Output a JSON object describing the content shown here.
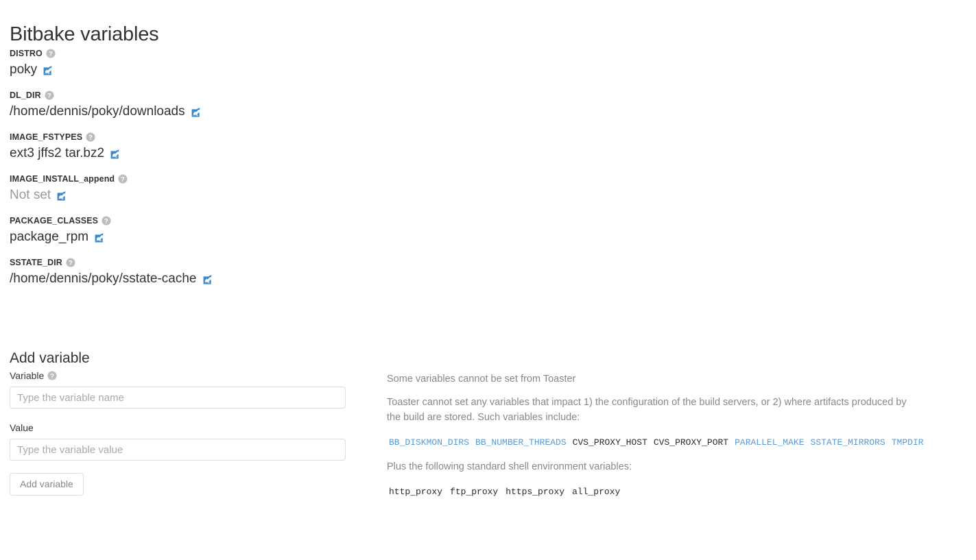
{
  "page": {
    "title": "Bitbake variables"
  },
  "variables": [
    {
      "name": "DISTRO",
      "value": "poky",
      "not_set": false,
      "help_icon": "help-circle-icon",
      "edit_icon": "edit-pencil-square-icon"
    },
    {
      "name": "DL_DIR",
      "value": "/home/dennis/poky/downloads",
      "not_set": false,
      "help_icon": "help-circle-icon",
      "edit_icon": "edit-pencil-square-icon"
    },
    {
      "name": "IMAGE_FSTYPES",
      "value": "ext3 jffs2 tar.bz2",
      "not_set": false,
      "help_icon": "help-circle-icon",
      "edit_icon": "edit-pencil-square-icon"
    },
    {
      "name": "IMAGE_INSTALL_append",
      "value": "Not set",
      "not_set": true,
      "help_icon": "help-circle-icon",
      "edit_icon": "edit-pencil-square-icon"
    },
    {
      "name": "PACKAGE_CLASSES",
      "value": "package_rpm",
      "not_set": false,
      "help_icon": "help-circle-icon",
      "edit_icon": "edit-pencil-square-icon"
    },
    {
      "name": "SSTATE_DIR",
      "value": "/home/dennis/poky/sstate-cache",
      "not_set": false,
      "help_icon": "help-circle-icon",
      "edit_icon": "edit-pencil-square-icon"
    }
  ],
  "add_variable_form": {
    "heading": "Add variable",
    "variable_label": "Variable",
    "variable_help_icon": "help-circle-icon",
    "variable_placeholder": "Type the variable name",
    "variable_value": "",
    "value_label": "Value",
    "value_placeholder": "Type the variable value",
    "value_value": "",
    "submit_label": "Add variable"
  },
  "info_panel": {
    "heading": "Some variables cannot be set from Toaster",
    "paragraph": "Toaster cannot set any variables that impact 1) the configuration of the build servers, or 2) where artifacts produced by the build are stored. Such variables include:",
    "restricted_variables": [
      {
        "name": "BB_DISKMON_DIRS",
        "is_link": true
      },
      {
        "name": "BB_NUMBER_THREADS",
        "is_link": true
      },
      {
        "name": "CVS_PROXY_HOST",
        "is_link": false
      },
      {
        "name": "CVS_PROXY_PORT",
        "is_link": false
      },
      {
        "name": "PARALLEL_MAKE",
        "is_link": true
      },
      {
        "name": "SSTATE_MIRRORS",
        "is_link": true
      },
      {
        "name": "TMPDIR",
        "is_link": true
      }
    ],
    "shell_intro": "Plus the following standard shell environment variables:",
    "shell_variables": [
      {
        "name": "http_proxy"
      },
      {
        "name": "ftp_proxy"
      },
      {
        "name": "https_proxy"
      },
      {
        "name": "all_proxy"
      }
    ]
  },
  "colors": {
    "link_blue": "#5a9bd5",
    "edit_icon_blue": "#3a87cd",
    "help_icon_grey": "#bdbdbd",
    "text_dark": "#333333",
    "text_muted": "#888888",
    "placeholder_grey": "#aaaaaa",
    "border_grey": "#dddddd"
  }
}
